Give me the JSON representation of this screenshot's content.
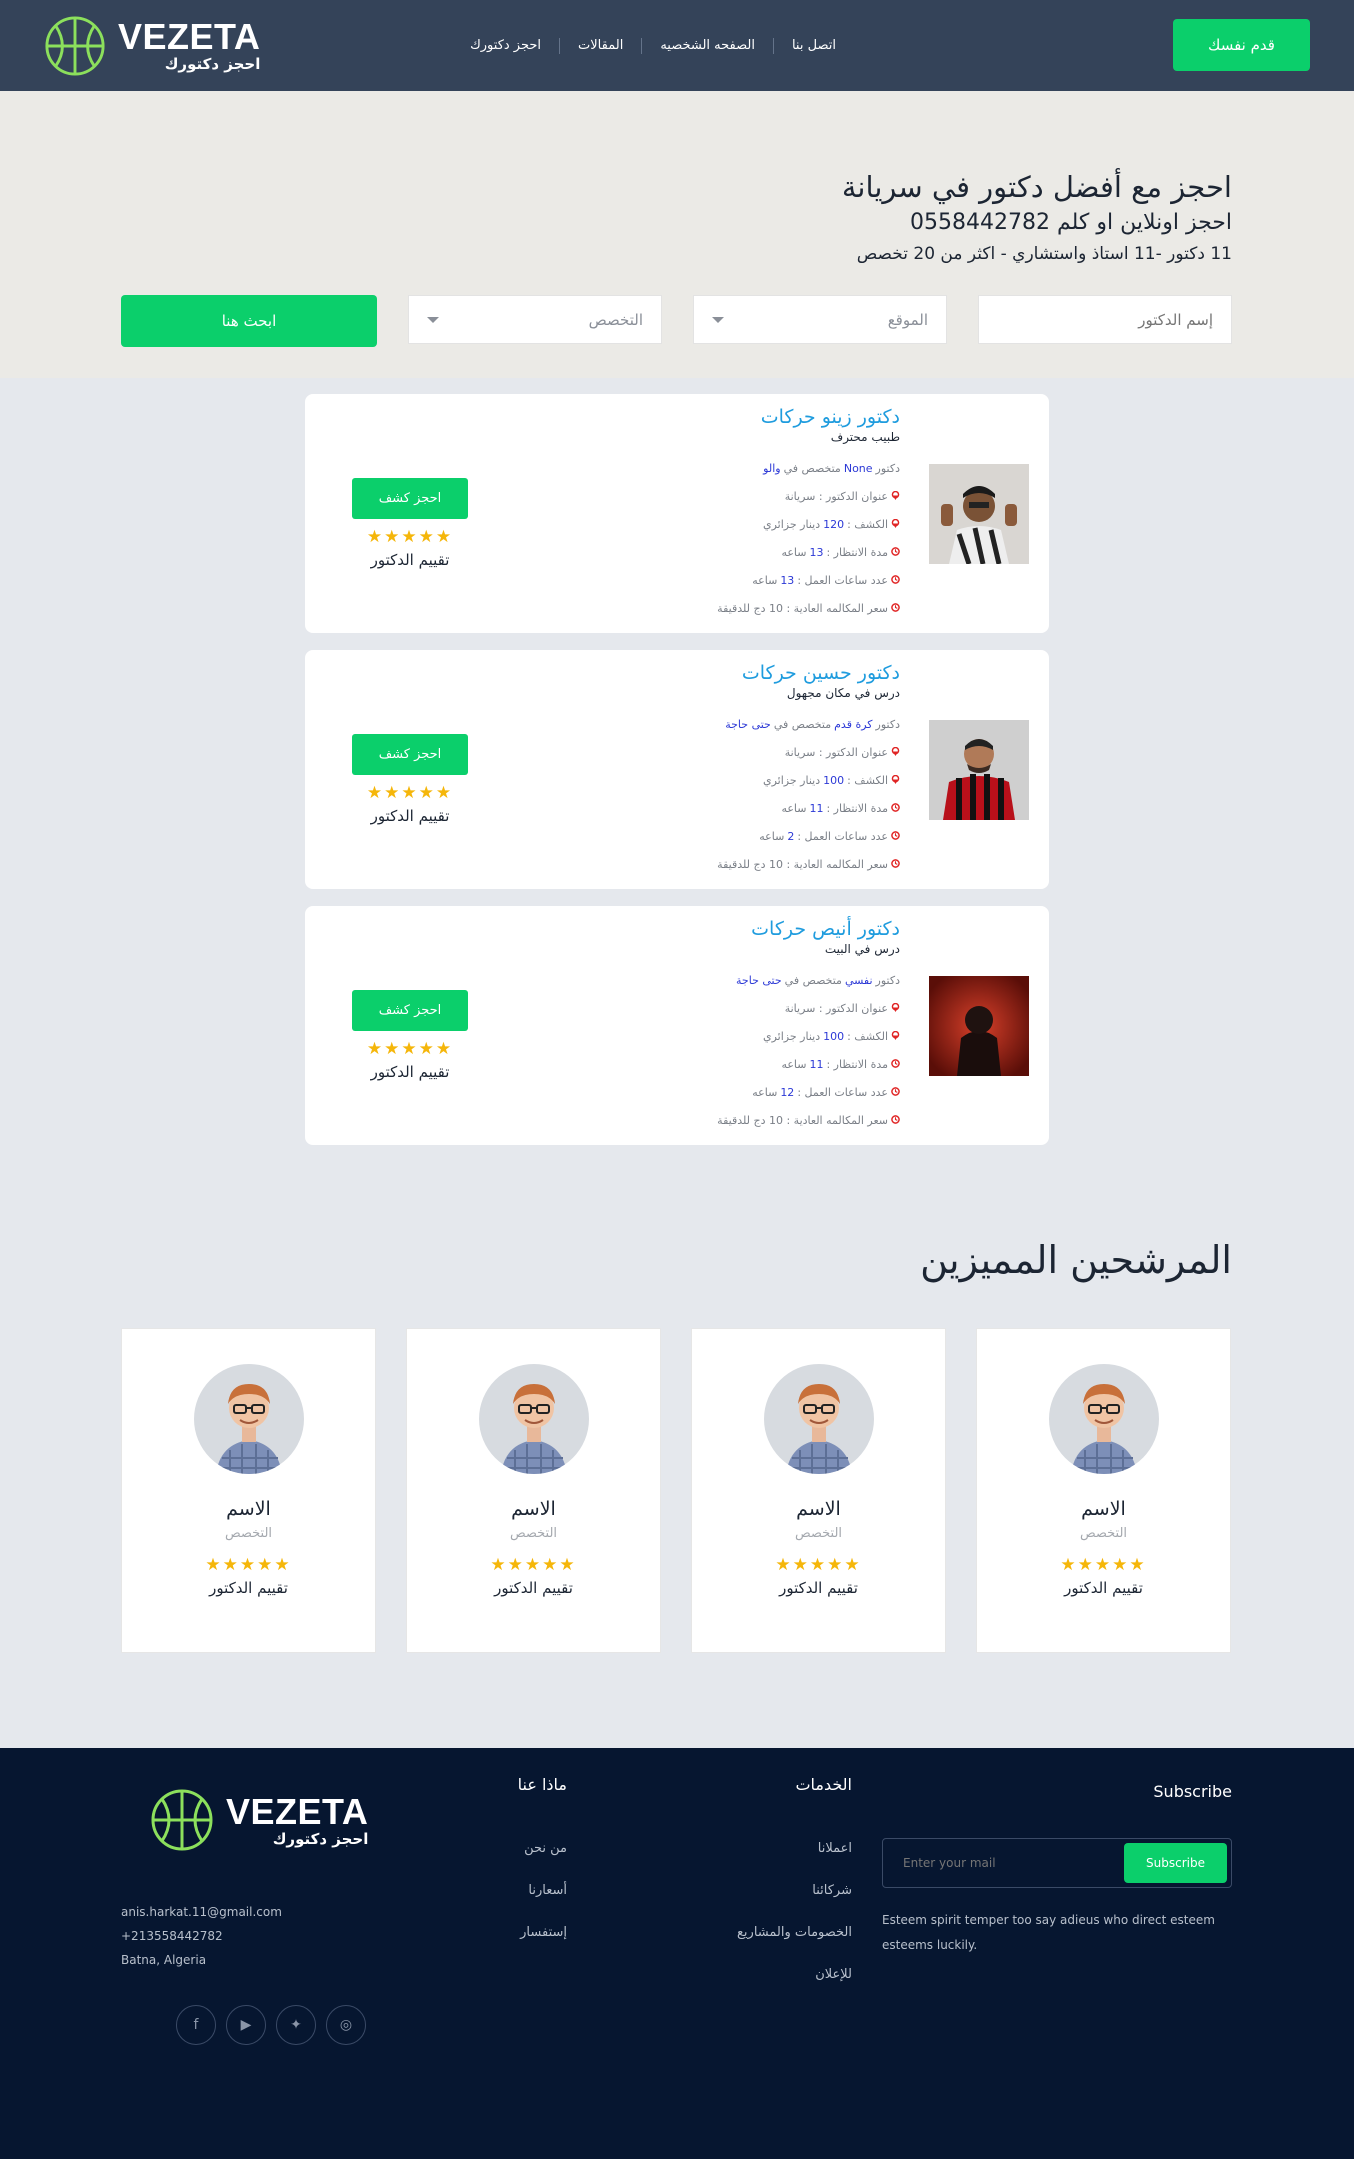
{
  "header": {
    "brand": "VEZETA",
    "tagline": "احجز دكتورك",
    "nav": [
      "احجز دكتورك",
      "المقالات",
      "الصفحه الشخصيه",
      "اتصل بنا"
    ],
    "cta": "قدم نفسك"
  },
  "hero": {
    "title": "احجز مع أفضل دكتور في سريانة",
    "phone": "احجز اونلاين او كلم 0558442782",
    "stats": "11 دكتور -11 استاذ واستشاري - اكثر من 20 تخصص",
    "name_placeholder": "إسم الدكتور",
    "location_placeholder": "الموقع",
    "specialty_placeholder": "التخصص",
    "search_button": "ابحث هنا"
  },
  "labels": {
    "doctor_word": "دكتور",
    "specialized_in": "متخصص في",
    "address": "عنوان الدكتور : سريانة",
    "fee_prefix": "الكشف :",
    "fee_suffix": "دينار جزائري",
    "wait_prefix": "مدة الانتظار :",
    "hours_word": "ساعه",
    "work_prefix": "عدد ساعات العمل :",
    "call_price": "سعر المكالمه العادية : 10 دج للدقيقة",
    "book_button": "احجز كشف",
    "rating_label": "تقييم الدكتور",
    "stars": "★★★★★"
  },
  "doctors": [
    {
      "name": "دكتور زينو حركات",
      "subtitle": "طبيب محترف",
      "field": "None",
      "place": "والو",
      "fee": "120",
      "wait": "13",
      "hours": "13"
    },
    {
      "name": "دكتور حسين حركات",
      "subtitle": "درس في مكان مجهول",
      "field": "كرة قدم",
      "place": "حتى حاجة",
      "fee": "100",
      "wait": "11",
      "hours": "2"
    },
    {
      "name": "دكتور أنيص حركات",
      "subtitle": "درس في البيت",
      "field": "نفسي",
      "place": "حتى حاجة",
      "fee": "100",
      "wait": "11",
      "hours": "12"
    }
  ],
  "featured": {
    "title": "المرشحين المميزين",
    "cards": [
      {
        "name": "الاسم",
        "specialty": "التخصص"
      },
      {
        "name": "الاسم",
        "specialty": "التخصص"
      },
      {
        "name": "الاسم",
        "specialty": "التخصص"
      },
      {
        "name": "الاسم",
        "specialty": "التخصص"
      }
    ]
  },
  "footer": {
    "email": "anis.harkat.11@gmail.com",
    "phone": "+213558442782",
    "location": "Batna, Algeria",
    "about_title": "ماذا عنا",
    "about_links": [
      "من نحن",
      "أسعارنا",
      "إستفسار"
    ],
    "services_title": "الخدمات",
    "services_links": [
      "اعملانا",
      "شركائنا",
      "الخصومات والمشاريع",
      "للإعلان"
    ],
    "subscribe_title": "Subscribe",
    "subscribe_placeholder": "Enter your mail",
    "subscribe_button": "Subscribe",
    "subscribe_desc": "Esteem spirit temper too say adieus who direct esteem esteems luckily.",
    "social": [
      "facebook-icon",
      "youtube-icon",
      "twitter-icon",
      "instagram-icon"
    ]
  },
  "colors": {
    "accent": "#0bcf6b",
    "header_bg": "#344359",
    "footer_bg": "#061630",
    "doctor_name": "#1f9cde",
    "highlight": "#2c39d6",
    "star": "#f5b60a"
  }
}
